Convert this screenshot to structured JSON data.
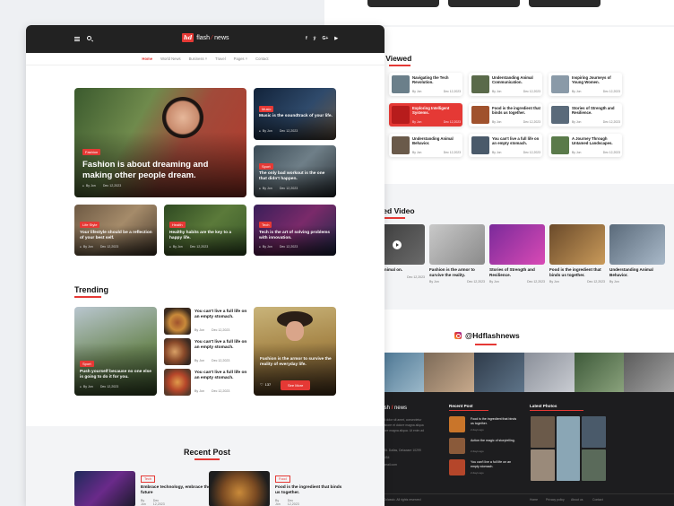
{
  "back": {
    "most_viewed_title": "Most Viewed",
    "most_viewed_partial": ": Viewed",
    "most_viewed": [
      {
        "title": "Navigating the Tech Revolution.",
        "author": "By Jon",
        "date": "Dec 12,2023",
        "active": false
      },
      {
        "title": "Understanding Animal Communication.",
        "author": "By Jon",
        "date": "Dec 12,2023",
        "active": false
      },
      {
        "title": "Inspiring Journeys of Young Women.",
        "author": "By Jon",
        "date": "Dec 12,2023",
        "active": false
      },
      {
        "title": "Exploring Intelligent Systems.",
        "author": "By Jon",
        "date": "Dec 12,2023",
        "active": true
      },
      {
        "title": "Food is the ingredient that binds us together.",
        "author": "By Jon",
        "date": "Dec 12,2023",
        "active": false
      },
      {
        "title": "Stories of Strength and Resilience.",
        "author": "By Jon",
        "date": "Dec 12,2023",
        "active": false
      },
      {
        "title": "Understanding Animal Behavior.",
        "author": "By Jon",
        "date": "Dec 12,2023",
        "active": false
      },
      {
        "title": "You can't live a full life on an empty stomach.",
        "author": "By Jon",
        "date": "Dec 12,2023",
        "active": false
      },
      {
        "title": "A Journey Through Untamed Landscapes.",
        "author": "By Jon",
        "date": "Dec 12,2023",
        "active": false
      }
    ],
    "featured_title": "red Video",
    "featured": [
      {
        "title": "nding Animal on.",
        "author": "",
        "date": "Dec 12,2023"
      },
      {
        "title": "Fashion is the armor to survive the reality.",
        "author": "By Jon",
        "date": "Dec 12,2023"
      },
      {
        "title": "Stories of Strength and Resilience.",
        "author": "By Jon",
        "date": "Dec 12,2023"
      },
      {
        "title": "Food is the ingredient that binds us together.",
        "author": "By Jon",
        "date": "Dec 12,2023"
      },
      {
        "title": "Understanding Animal Behavior.",
        "author": "By Jon",
        "date": ""
      }
    ],
    "instagram_handle": "@Hdflashnews",
    "footer": {
      "logo": "flash news",
      "logo_prefix": "lash",
      "logo_suffix": "news",
      "about_lines": [
        "and dolor sit amet, consectetur",
        "ut labore et dolore magna aliqua",
        "dolore magna aliqua. Ut enim ad"
      ],
      "address": "13 St. Dallas, Delaware 10299",
      "phone": "5-3454",
      "email": "@gmail.com",
      "recent_title": "Recent Post",
      "recent": [
        {
          "title": "Food is the ingredient that binds us together.",
          "date": "2 days ago"
        },
        {
          "title": "Action the magic of storytelling.",
          "date": "2 days ago"
        },
        {
          "title": "You can't live a full life on an empty stomach.",
          "date": "2 days ago"
        }
      ],
      "photos_title": "Latest Photos",
      "copyright": "Dclassic. All rights reserved",
      "links": [
        "Home",
        "Privacy policy",
        "About us",
        "Contact"
      ]
    }
  },
  "front": {
    "logo_mark": "hd",
    "logo_name_a": "flash",
    "logo_name_sep": "⁄",
    "logo_name_b": "news",
    "socials": [
      "f",
      "ẏ",
      "G+",
      "▶"
    ],
    "menu": [
      {
        "label": "Home",
        "active": true
      },
      {
        "label": "World News",
        "active": false
      },
      {
        "label": "Business ˅",
        "active": false
      },
      {
        "label": "Travel",
        "active": false
      },
      {
        "label": "Pages ˅",
        "active": false
      },
      {
        "label": "Contact",
        "active": false
      }
    ],
    "hero": {
      "badge": "Fashion",
      "title": "Fashion is about dreaming and making other people dream.",
      "author": "By Jon",
      "date": "Dec 12,2023"
    },
    "side": [
      {
        "badge": "Music",
        "title": "Music is the soundtrack of your life.",
        "author": "By Jon",
        "date": "Dec 12,2023"
      },
      {
        "badge": "Sport",
        "title": "The only bad workout is the one that didn't happen.",
        "author": "By Jon",
        "date": "Dec 12,2023"
      }
    ],
    "row": [
      {
        "badge": "Life Style",
        "title": "Your lifestyle should be a reflection of your best self.",
        "author": "By Jon",
        "date": "Dec 12,2023"
      },
      {
        "badge": "Health",
        "title": "Healthy habits are the key to a happy life.",
        "author": "By Jon",
        "date": "Dec 12,2023"
      },
      {
        "badge": "Tech",
        "title": "Tech is the art of solving problems with innovation.",
        "author": "By Jon",
        "date": "Dec 12,2023"
      }
    ],
    "trending_title": "Trending",
    "trending_main": {
      "badge": "Sport",
      "title": "Push yourself because no one else is going to do it for you.",
      "author": "By Jon",
      "date": "Dec 12,2023"
    },
    "trending_list": [
      {
        "title": "You can't live a full life on an empty stomach.",
        "author": "By Jon",
        "date": "Dec 12,2023"
      },
      {
        "title": "You can't live a full life on an empty stomach.",
        "author": "By Jon",
        "date": "Dec 12,2023"
      },
      {
        "title": "You can't live a full life on an empty stomach.",
        "author": "By Jon",
        "date": "Dec 12,2023"
      }
    ],
    "promo": {
      "title": "Fashion is the armor to survive the reality of everyday life.",
      "likes": "137",
      "button": "See More"
    },
    "recent_title": "Recent Post",
    "recent": [
      {
        "badge": "Tech",
        "title": "Embrace technology, embrace the future",
        "author": "By Jon",
        "date": "Dec 12,2023"
      },
      {
        "badge": "Food",
        "title": "Food is the ingredient that binds us together.",
        "author": "By Jon",
        "date": "Dec 12,2023"
      }
    ]
  },
  "colors": {
    "accent": "#e53935",
    "nav": "#222222",
    "footer": "#1d1d1f"
  }
}
